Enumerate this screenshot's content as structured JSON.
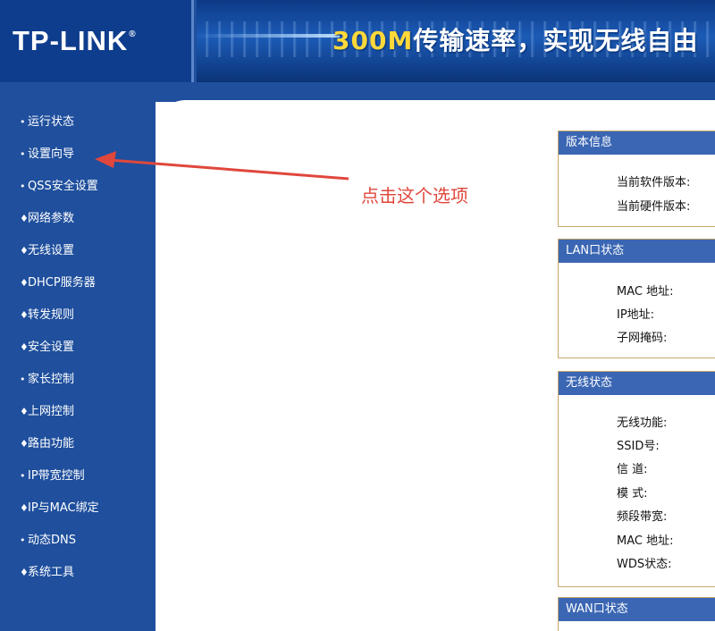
{
  "header": {
    "logo": "TP-LINK",
    "logo_mark": "®",
    "slogan_accent": "300M",
    "slogan_rest": "传输速率，实现无线自由"
  },
  "sidebar": {
    "items": [
      {
        "label": "运行状态"
      },
      {
        "label": "设置向导"
      },
      {
        "label": "QSS安全设置"
      },
      {
        "label": "网络参数"
      },
      {
        "label": "无线设置"
      },
      {
        "label": "DHCP服务器"
      },
      {
        "label": "转发规则"
      },
      {
        "label": "安全设置"
      },
      {
        "label": "家长控制"
      },
      {
        "label": "上网控制"
      },
      {
        "label": "路由功能"
      },
      {
        "label": "IP带宽控制"
      },
      {
        "label": "IP与MAC绑定"
      },
      {
        "label": "动态DNS"
      },
      {
        "label": "系统工具"
      }
    ]
  },
  "annotation": {
    "text": "点击这个选项",
    "color": "#e0473c"
  },
  "panels": {
    "version": {
      "title": "版本信息",
      "rows": [
        "当前软件版本:",
        "当前硬件版本:"
      ]
    },
    "lan": {
      "title": "LAN口状态",
      "rows": [
        "MAC 地址:",
        "IP地址:",
        "子网掩码:"
      ]
    },
    "wireless": {
      "title": "无线状态",
      "rows": [
        "无线功能:",
        "SSID号:",
        "信 道:",
        "模 式:",
        "频段带宽:",
        "MAC 地址:",
        "WDS状态:"
      ]
    },
    "wan": {
      "title": "WAN口状态"
    }
  },
  "colors": {
    "nav_bg": "#1f4f9d",
    "panel_header": "#3a66b3",
    "slogan_accent": "#ffd83a"
  }
}
